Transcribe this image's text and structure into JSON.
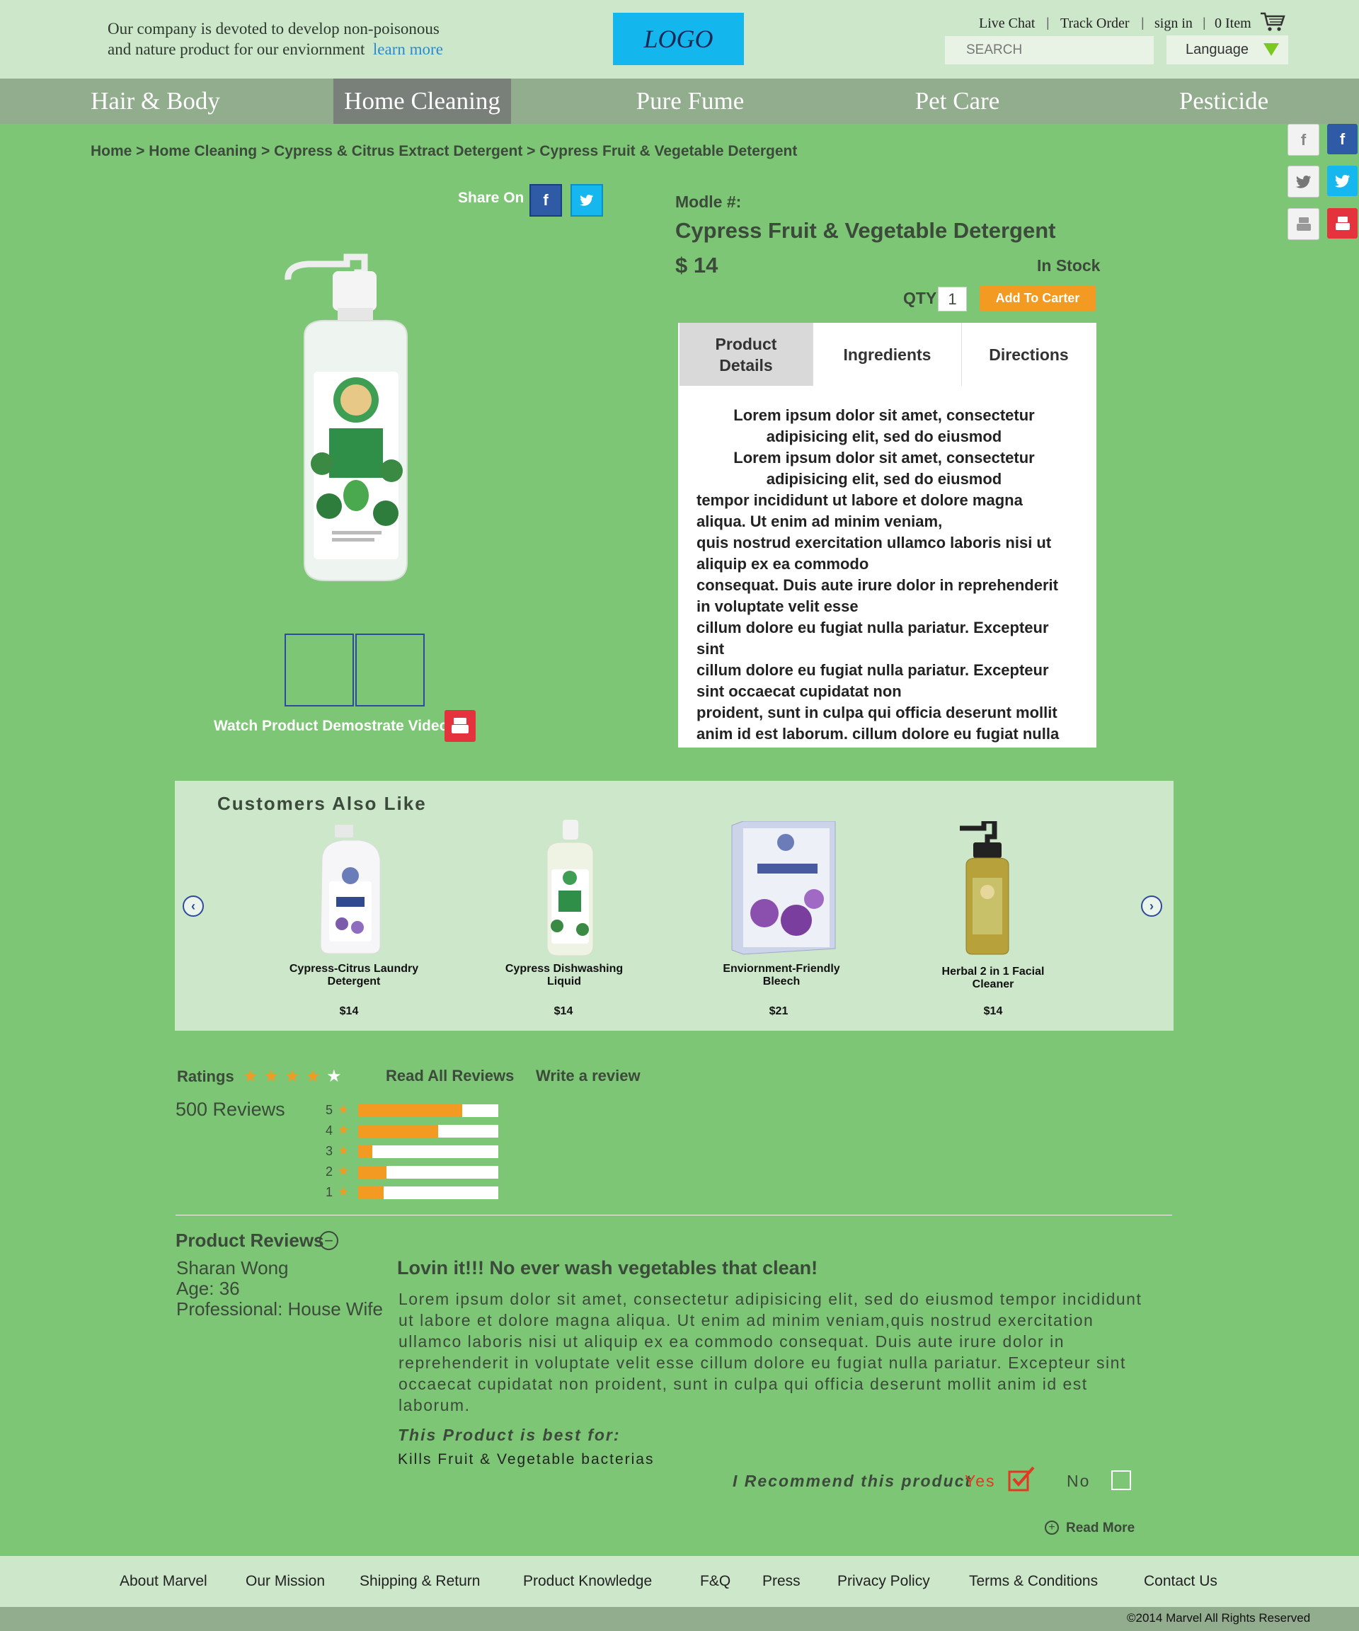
{
  "top": {
    "tagline_line1": "Our company is devoted to develop non-poisonous",
    "tagline_line2": "and nature product for our enviornment",
    "learn_more": "learn more",
    "logo": "LOGO",
    "live_chat": "Live Chat",
    "track_order": "Track Order",
    "sign_in": "sign in",
    "cart": "0 Item",
    "search_placeholder": "SEARCH",
    "language": "Language",
    "separator": "|"
  },
  "nav": [
    "Hair & Body",
    "Home Cleaning",
    "Pure Fume",
    "Pet Care",
    "Pesticide"
  ],
  "breadcrumb": "Home > Home Cleaning > Cypress & Citrus Extract Detergent > Cypress Fruit & Vegetable Detergent",
  "share": {
    "label": "Share On",
    "facebook": "f",
    "twitter": "t"
  },
  "media": {
    "video_label": "Watch Product Demostrate Video"
  },
  "product": {
    "model_label": "Modle #:",
    "title": "Cypress Fruit & Vegetable Detergent",
    "price": "$ 14",
    "stock": "In Stock",
    "qty_label": "QTY",
    "qty": "1",
    "add_button": "Add To Carter"
  },
  "tabs": {
    "details_line1": "Product",
    "details_line2": "Details",
    "ingredients": "Ingredients",
    "directions": "Directions",
    "body": [
      "Lorem ipsum dolor sit amet, consectetur adipisicing elit, sed do eiusmod",
      "Lorem ipsum dolor sit amet, consectetur adipisicing elit, sed do eiusmod",
      "tempor incididunt ut labore et dolore magna aliqua. Ut enim ad minim veniam,",
      "quis nostrud exercitation ullamco laboris nisi ut aliquip ex ea commodo",
      "consequat. Duis aute irure dolor in reprehenderit in voluptate velit esse",
      "cillum dolore eu fugiat nulla pariatur. Excepteur sint",
      "cillum dolore eu fugiat nulla pariatur. Excepteur sint occaecat cupidatat non",
      "proident, sunt in culpa qui officia deserunt mollit anim id est laborum. cillum dolore eu fugiat nulla"
    ]
  },
  "also_like": {
    "title": "Customers Also Like",
    "items": [
      {
        "name_line1": "Cypress-Citrus Laundry",
        "name_line2": "Detergent",
        "price": "$14"
      },
      {
        "name_line1": "Cypress Dishwashing",
        "name_line2": "Liquid",
        "price": "$14"
      },
      {
        "name_line1": "Enviornment-Friendly",
        "name_line2": "Bleech",
        "price": "$21"
      },
      {
        "name_line1": "Herbal 2 in 1 Facial",
        "name_line2": "Cleaner",
        "price": "$14"
      }
    ]
  },
  "ratings": {
    "label": "Ratings",
    "stars": 4,
    "read_all": "Read All Reviews",
    "write": "Write a review",
    "count": "500 Reviews",
    "breakdown": [
      {
        "star": "5",
        "fraction": 0.74
      },
      {
        "star": "4",
        "fraction": 0.57
      },
      {
        "star": "3",
        "fraction": 0.1
      },
      {
        "star": "2",
        "fraction": 0.2
      },
      {
        "star": "1",
        "fraction": 0.18
      }
    ]
  },
  "review": {
    "heading": "Product Reviews",
    "name": "Sharan Wong",
    "age": "Age: 36",
    "profession": "Professional: House Wife",
    "title": "Lovin it!!! No ever wash vegetables that clean!",
    "body": "Lorem ipsum dolor sit amet, consectetur adipisicing elit, sed do eiusmod tempor incididunt ut labore et dolore magna aliqua. Ut enim ad minim veniam,quis nostrud exercitation ullamco laboris nisi ut aliquip ex ea commodo consequat. Duis aute irure dolor in reprehenderit in voluptate velit esse cillum dolore eu fugiat nulla pariatur. Excepteur sint occaecat cupidatat non proident, sunt in culpa qui officia deserunt mollit anim id est laborum.",
    "best_for_label": "This Product is best for:",
    "best_for": "Kills Fruit & Vegetable bacterias",
    "recommend": "I Recommend this product",
    "yes": "Yes",
    "no": "No",
    "read_more": "Read More"
  },
  "footer": {
    "links": [
      "About Marvel",
      "Our Mission",
      "Shipping & Return",
      "Product Knowledge",
      "F&Q",
      "Press",
      "Privacy Policy",
      "Terms & Conditions",
      "Contact Us"
    ],
    "copyright": "©2014 Marvel  All Rights Reserved"
  },
  "colors": {
    "bg": "#7dc675",
    "pale": "#cde7cb",
    "nav": "#92ac8e",
    "accent": "#f39a22",
    "logo": "#14b6ee"
  }
}
